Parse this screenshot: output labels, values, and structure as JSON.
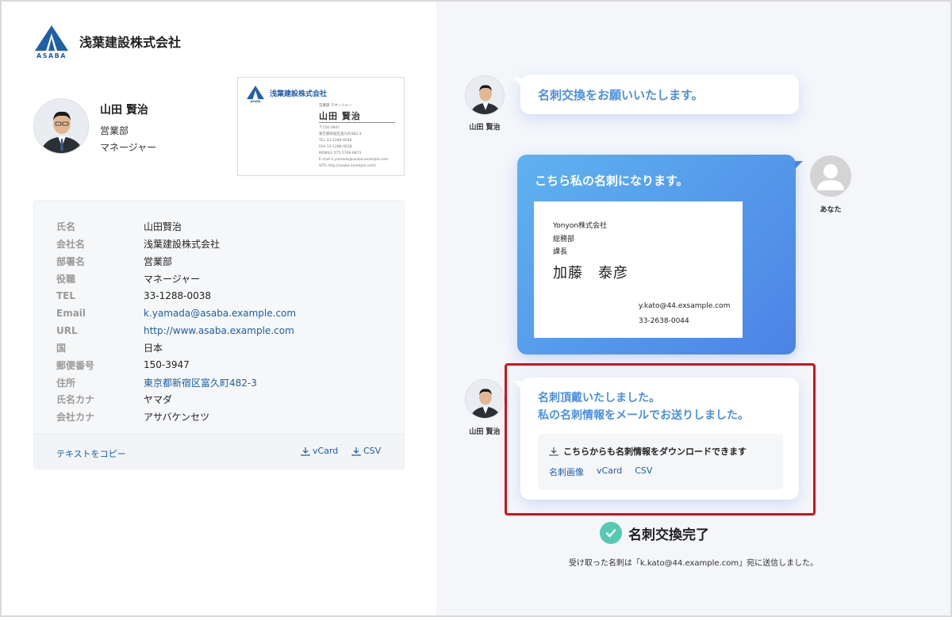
{
  "brand": {
    "logo_text": "ASABA",
    "company_name": "浅葉建設株式会社",
    "color": "#1f5fa8"
  },
  "profile": {
    "name": "山田 賢治",
    "department": "営業部",
    "position": "マネージャー",
    "avatar_icon": "person-photo-icon"
  },
  "card_thumbnail": {
    "company": "浅葉建設株式会社",
    "dept_line": "営業部 マネージャー",
    "name": "山田 賢治",
    "lines": [
      "〒150-3947",
      "東京都新宿区富久町482-3",
      "TEL 33-1288-0038",
      "FAX 33-1288-0038",
      "MOBILE 075-5708-6873",
      "E-mail k.yamada@asaba.example.com",
      "SITE http://asaba.example.com/"
    ]
  },
  "info": {
    "rows": [
      {
        "label": "氏名",
        "value": "山田賢治"
      },
      {
        "label": "会社名",
        "value": "浅葉建設株式会社"
      },
      {
        "label": "部署名",
        "value": "営業部"
      },
      {
        "label": "役職",
        "value": "マネージャー"
      },
      {
        "label": "TEL",
        "value": "33-1288-0038"
      },
      {
        "label": "Email",
        "value": "k.yamada@asaba.example.com"
      },
      {
        "label": "URL",
        "value": "http://www.asaba.example.com"
      },
      {
        "label": "国",
        "value": "日本"
      },
      {
        "label": "郵便番号",
        "value": "150-3947"
      },
      {
        "label": "住所",
        "value": "東京都新宿区富久町482-3"
      },
      {
        "label": "氏名カナ",
        "value": "ヤマダ"
      },
      {
        "label": "会社カナ",
        "value": "アサバケンセツ"
      }
    ],
    "copy_label": "テキストをコピー",
    "vcard_label": "vCard",
    "csv_label": "CSV",
    "link_color": "#1a5fa8"
  },
  "chat": {
    "sender_label": "山田 賢治",
    "msg1": "名刺交換をお願いいたします。",
    "msg2": "こちら私の名刺になります。",
    "you_label": "あなた",
    "my_card": {
      "company": "Yonyon株式会社",
      "department": "総務部",
      "title": "課長",
      "name": "加藤　泰彦",
      "email": "y.kato@44.exsample.com",
      "tel": "33-2638-0044"
    },
    "msg3_line1": "名刺頂戴いたしました。",
    "msg3_line2": "私の名刺情報をメールでお送りしました。",
    "download_heading": "こちらからも名刺情報をダウンロードできます",
    "download_links": [
      "名刺画像",
      "vCard",
      "CSV"
    ],
    "accent": "#4a90e2",
    "highlight_color": "#d0121b"
  },
  "completion": {
    "title": "名刺交換完了",
    "message": "受け取った名刺は「k.kato@44.example.com」宛に送信しました。",
    "check_color": "#56c9b5"
  }
}
